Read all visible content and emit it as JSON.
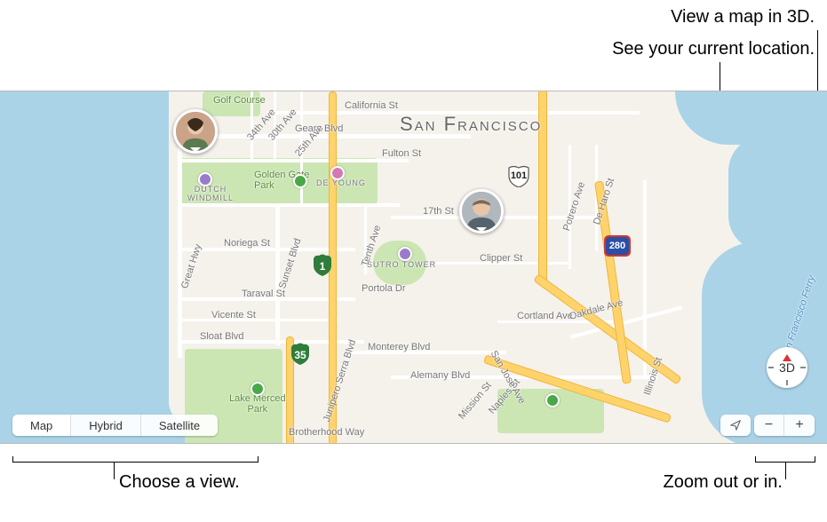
{
  "callouts": {
    "view3d": "View a map in 3D.",
    "location": "See your current location.",
    "chooseView": "Choose a view.",
    "zoom": "Zoom out or in."
  },
  "map": {
    "city": "San Francisco",
    "streets": {
      "golfCourse": "Golf Course",
      "california": "California St",
      "geary": "Geary Blvd",
      "th34": "34th Ave",
      "th30": "30th Ave",
      "th25": "25th Ave",
      "fulton": "Fulton St",
      "noriega": "Noriega St",
      "taraval": "Taraval St",
      "vicente": "Vicente St",
      "sloat": "Sloat Blvd",
      "greatHwy": "Great Hwy",
      "brotherhood": "Brotherhood Way",
      "th17": "17th St",
      "clipper": "Clipper St",
      "portola": "Portola Dr",
      "monterey": "Monterey Blvd",
      "alemany": "Alemany Blvd",
      "juniperoSerra": "Junipero Serra Blvd",
      "tenthAve": "Tenth Ave",
      "potrero": "Potrero Ave",
      "sanJose": "San Jose Ave",
      "deHaro": "De Haro St",
      "cortland": "Cortland Ave",
      "oakdale": "Oakdale Ave",
      "naples": "Naples St",
      "mission": "Mission St",
      "illinois": "Illinois St",
      "sfFerry": "San Francisco Ferry",
      "sunsetBlvd": "Sunset Blvd"
    },
    "landmarks": {
      "dutchWindmill": "DUTCH\nWINDMILL",
      "goldenGate": "Golden Gate\nPark",
      "deYoung": "DE YOUNG",
      "sutroTower": "SUTRO TOWER",
      "lakeMerced": "Lake Merced\nPark"
    },
    "shields": {
      "hwy1": "1",
      "hwy35": "35",
      "us101": "101",
      "is280": "280"
    }
  },
  "controls": {
    "view": {
      "map": "Map",
      "hybrid": "Hybrid",
      "satellite": "Satellite"
    },
    "compass": "3D",
    "zoom": {
      "out": "−",
      "in": "+"
    }
  }
}
